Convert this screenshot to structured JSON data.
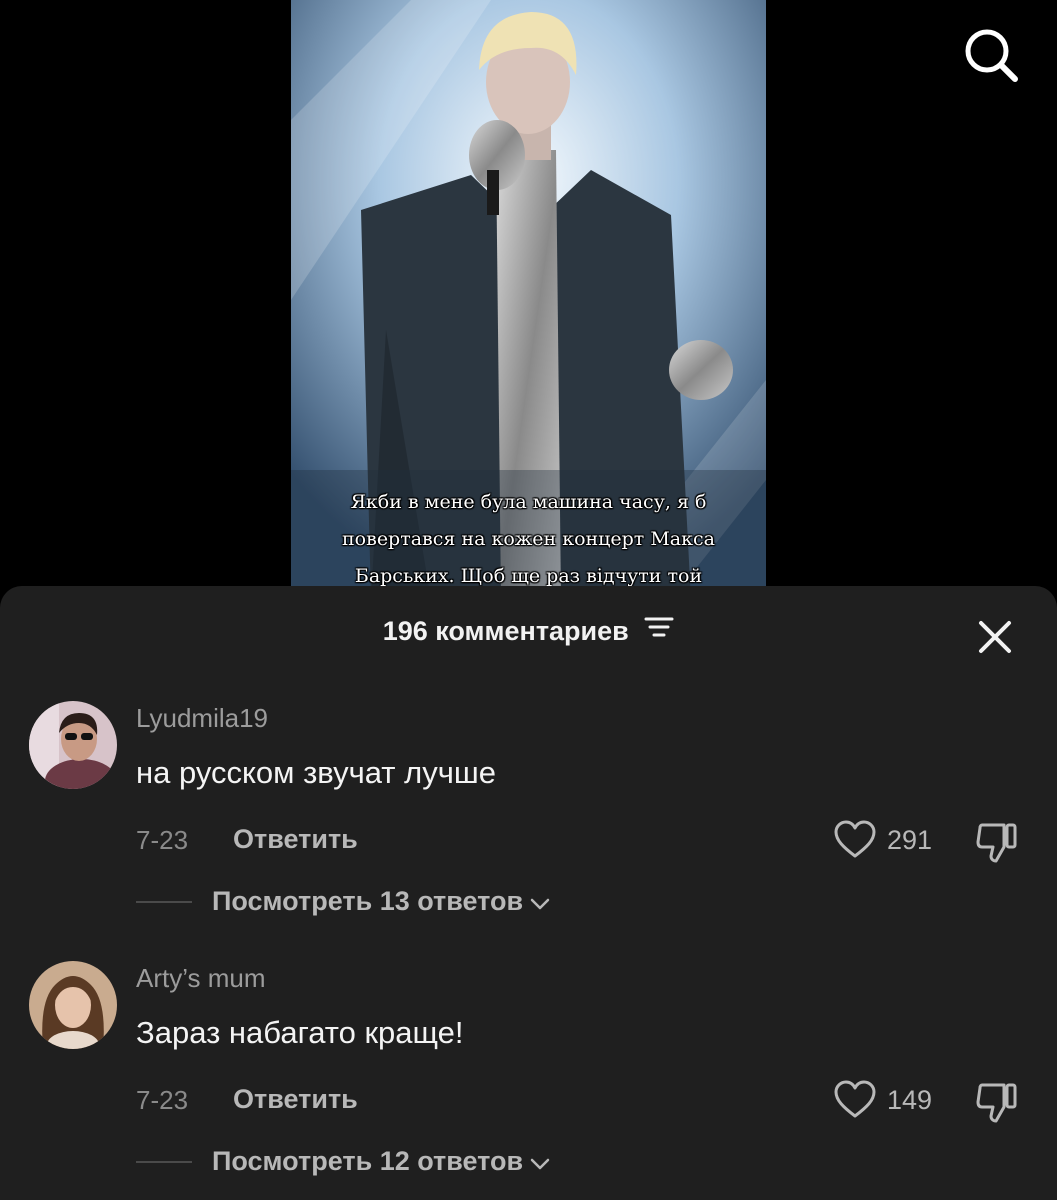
{
  "video": {
    "subtitle_lines": [
      "Якби в мене була машина часу, я б",
      "повертався на кожен концерт Макса",
      "Барських. Щоб ще раз відчути той"
    ]
  },
  "icons": {
    "search": "search-icon",
    "sort": "sort-lines-icon",
    "close": "close-icon",
    "like": "heart-icon",
    "dislike": "thumbs-down-icon",
    "chevron": "chevron-down-icon"
  },
  "sheet": {
    "title": "196 комментариев"
  },
  "comments": [
    {
      "username": "Lyudmila19",
      "text": "на русском звучат лучше",
      "date": "7-23",
      "reply_label": "Ответить",
      "likes": "291",
      "view_replies": "Посмотреть 13 ответов"
    },
    {
      "username": "Arty’s mum",
      "text": "Зараз набагато краще!",
      "date": "7-23",
      "reply_label": "Ответить",
      "likes": "149",
      "view_replies": "Посмотреть 12 ответов"
    }
  ],
  "colors": {
    "sheet_bg": "#1f1f1f",
    "text_primary": "#f4f4f4",
    "text_secondary": "#9c9c9c"
  }
}
